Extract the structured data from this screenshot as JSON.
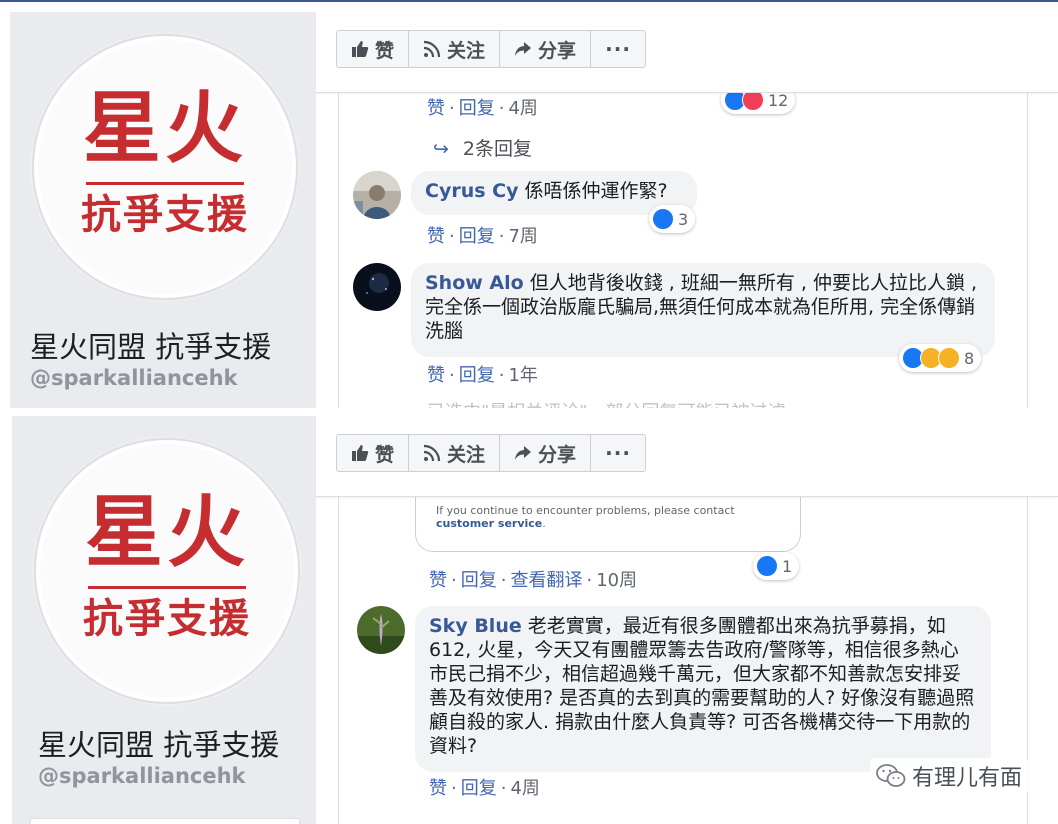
{
  "page": {
    "name": "星火同盟 抗爭支援",
    "handle": "@sparkalliancehk",
    "logo": {
      "line1": "星火",
      "line2": "抗爭支援"
    }
  },
  "toolbar": {
    "like": "赞",
    "follow": "关注",
    "share": "分享",
    "more": "···"
  },
  "meta_labels": {
    "like": "赞",
    "reply": "回复",
    "translate": "查看翻译",
    "sep": "·"
  },
  "panel1": {
    "top_meta_time": "4周",
    "top_reaction_count": "12",
    "replies_label": "2条回复",
    "comments": [
      {
        "author": "Cyrus Cy",
        "text": "係唔係仲運作緊?",
        "time": "7周",
        "reactions": "3"
      },
      {
        "author": "Show Alo",
        "text": "但人地背後收錢 , 班細一無所有 , 仲要比人拉比人鎖 , 完全係一個政治版龐氏騙局,無須任何成本就為佢所用, 完全係傳銷洗腦",
        "time": "1年",
        "reactions": "8"
      }
    ],
    "faded_text": "已选中\"最相关评论\"，部分回复可能已被过滤。"
  },
  "panel2": {
    "card_text": "If you continue to encounter problems, please contact",
    "card_link": "customer service",
    "card_end": ".",
    "top_meta_time": "10周",
    "top_reaction_count": "1",
    "comments": [
      {
        "author": "Sky Blue",
        "text": "老老實實，最近有很多團體都出來為抗爭募捐，如612, 火星，今天又有團體眾籌去告政府/警隊等，相信很多熱心市民己捐不少，相信超過幾千萬元，但大家都不知善款怎安排妥善及有效使用? 是否真的去到真的需要幫助的人? 好像沒有聽過照顧自殺的家人. 捐款由什麼人負責等? 可否各機構交待一下用款的資料?",
        "time": "4周"
      }
    ]
  },
  "watermark": "有理儿有面",
  "colors": {
    "accent": "#3b5998",
    "logo_red": "#c52d30",
    "link": "#385898"
  }
}
